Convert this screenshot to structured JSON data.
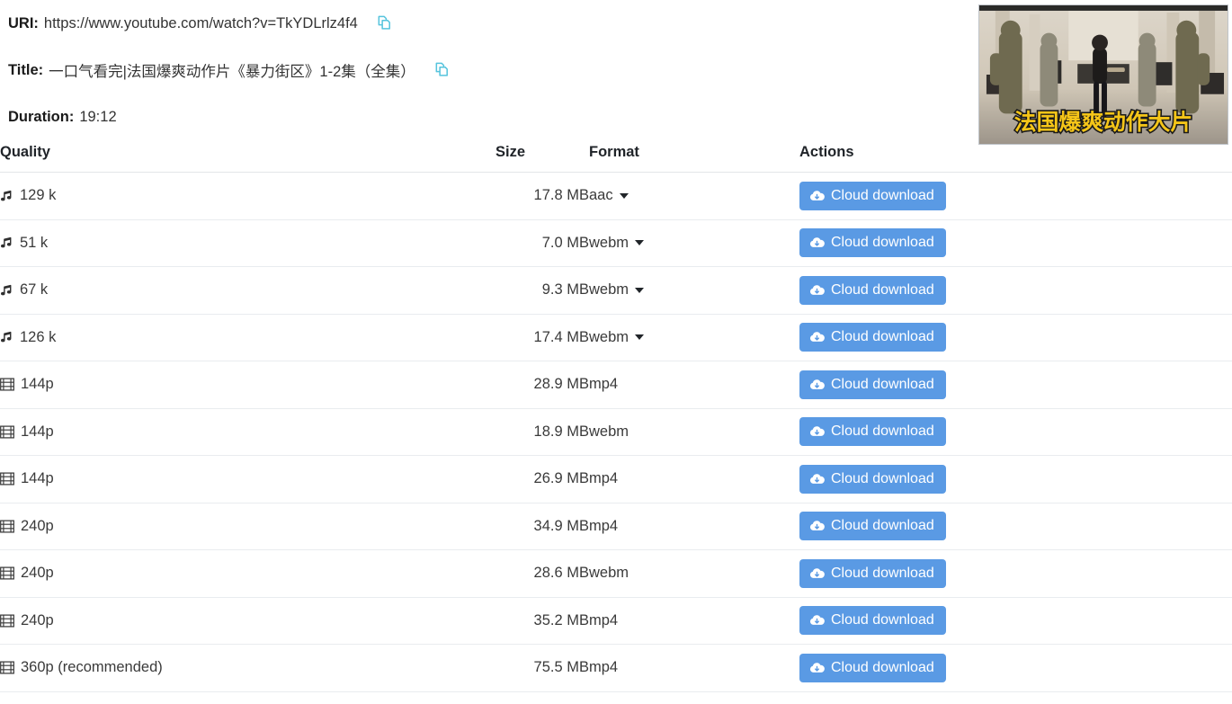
{
  "meta": {
    "uri_label": "URI:",
    "uri_value": "https://www.youtube.com/watch?v=TkYDLrlz4f4",
    "title_label": "Title:",
    "title_value": "一口气看完|法国爆爽动作片《暴力街区》1-2集（全集）",
    "duration_label": "Duration:",
    "duration_value": "19:12",
    "copy_icon": "copy-icon"
  },
  "thumbnail": {
    "overlay_text": "法国爆爽动作大片",
    "overlay_color": "#f5c518",
    "alt": "video-thumbnail"
  },
  "table": {
    "headers": {
      "quality": "Quality",
      "size": "Size",
      "format": "Format",
      "actions": "Actions"
    },
    "download_label": "Cloud download",
    "download_icon": "cloud-download-icon",
    "rows": [
      {
        "icon": "music-note-icon",
        "quality": "129 k",
        "size": "17.8 MB",
        "format": "aac",
        "has_caret": true
      },
      {
        "icon": "music-note-icon",
        "quality": "51 k",
        "size": "7.0 MB",
        "format": "webm",
        "has_caret": true
      },
      {
        "icon": "music-note-icon",
        "quality": "67 k",
        "size": "9.3 MB",
        "format": "webm",
        "has_caret": true
      },
      {
        "icon": "music-note-icon",
        "quality": "126 k",
        "size": "17.4 MB",
        "format": "webm",
        "has_caret": true
      },
      {
        "icon": "film-icon",
        "quality": "144p",
        "size": "28.9 MB",
        "format": "mp4",
        "has_caret": false
      },
      {
        "icon": "film-icon",
        "quality": "144p",
        "size": "18.9 MB",
        "format": "webm",
        "has_caret": false
      },
      {
        "icon": "film-icon",
        "quality": "144p",
        "size": "26.9 MB",
        "format": "mp4",
        "has_caret": false
      },
      {
        "icon": "film-icon",
        "quality": "240p",
        "size": "34.9 MB",
        "format": "mp4",
        "has_caret": false
      },
      {
        "icon": "film-icon",
        "quality": "240p",
        "size": "28.6 MB",
        "format": "webm",
        "has_caret": false
      },
      {
        "icon": "film-icon",
        "quality": "240p",
        "size": "35.2 MB",
        "format": "mp4",
        "has_caret": false
      },
      {
        "icon": "film-icon",
        "quality": "360p (recommended)",
        "size": "75.5 MB",
        "format": "mp4",
        "has_caret": false
      }
    ]
  },
  "colors": {
    "button_blue": "#5a9ae4",
    "copy_icon_blue": "#56c4dd",
    "row_border": "#e9ecef",
    "header_text": "#1f2328"
  }
}
